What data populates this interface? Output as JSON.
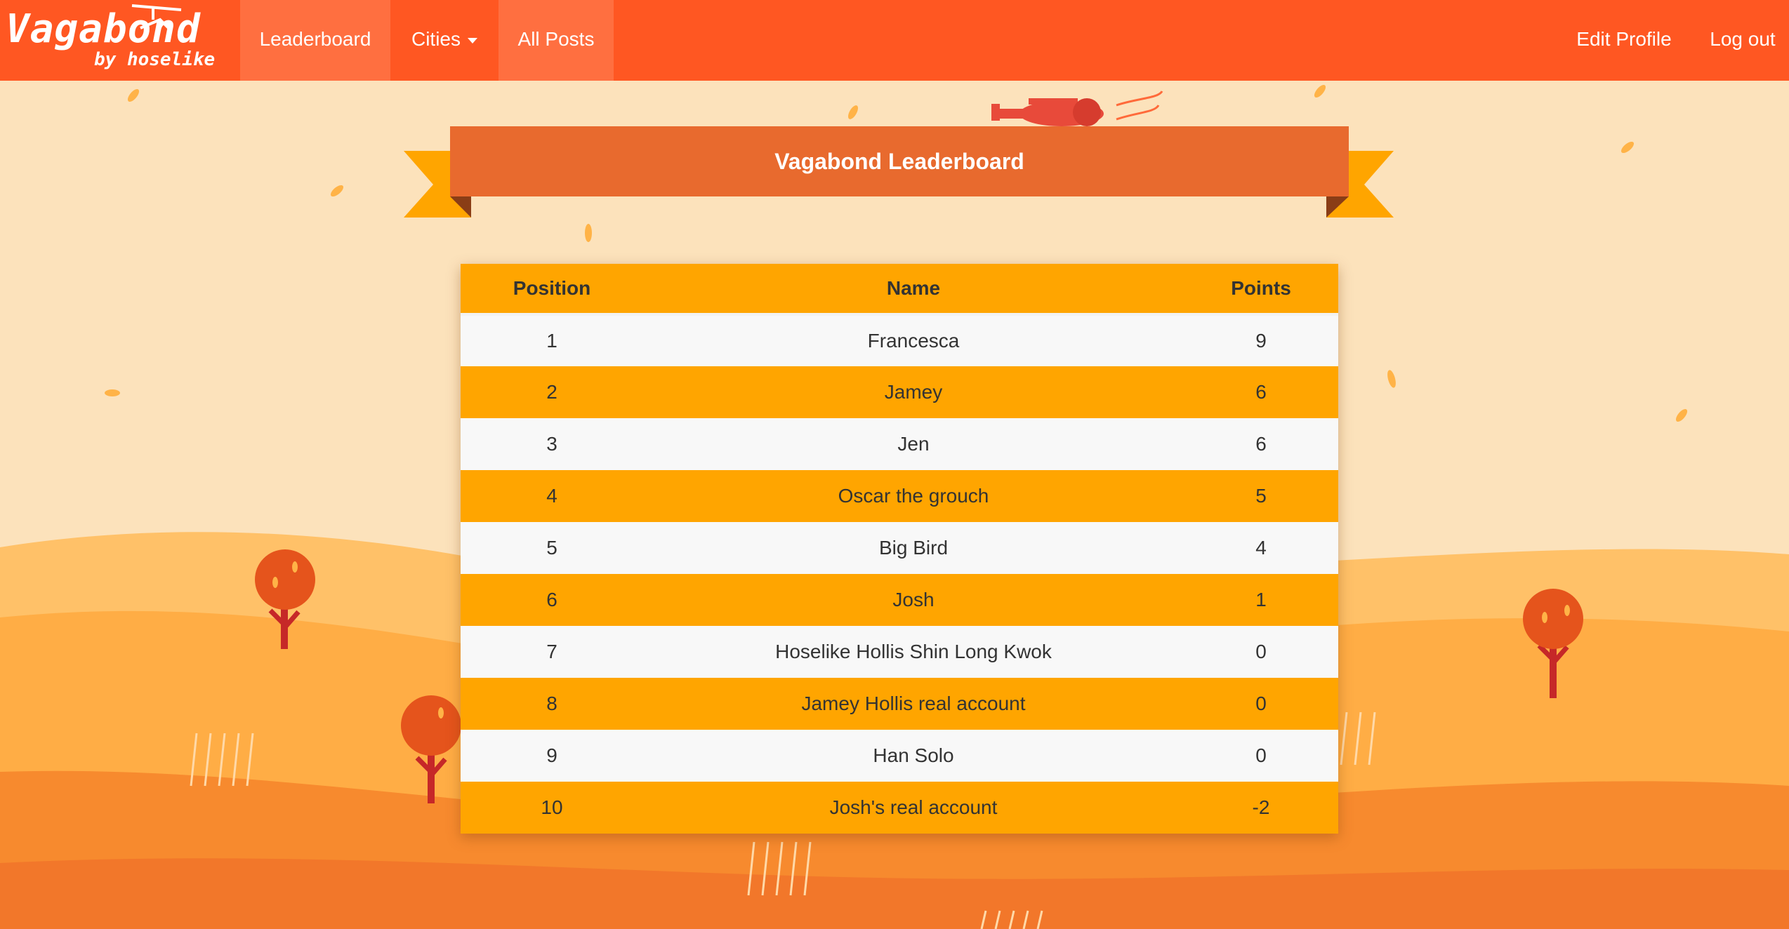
{
  "brand": {
    "name": "Vagabond",
    "tagline": "by hoselike",
    "logo_icon": "helicopter-icon"
  },
  "nav": {
    "leaderboard": "Leaderboard",
    "cities": "Cities",
    "all_posts": "All Posts",
    "edit_profile": "Edit Profile",
    "log_out": "Log out"
  },
  "banner": {
    "title": "Vagabond Leaderboard"
  },
  "table": {
    "headers": {
      "position": "Position",
      "name": "Name",
      "points": "Points"
    },
    "rows": [
      {
        "position": "1",
        "name": "Francesca",
        "points": "9"
      },
      {
        "position": "2",
        "name": "Jamey",
        "points": "6"
      },
      {
        "position": "3",
        "name": "Jen",
        "points": "6"
      },
      {
        "position": "4",
        "name": "Oscar the grouch",
        "points": "5"
      },
      {
        "position": "5",
        "name": "Big Bird",
        "points": "4"
      },
      {
        "position": "6",
        "name": "Josh",
        "points": "1"
      },
      {
        "position": "7",
        "name": "Hoselike Hollis Shin Long Kwok",
        "points": "0"
      },
      {
        "position": "8",
        "name": "Jamey Hollis real account",
        "points": "0"
      },
      {
        "position": "9",
        "name": "Han Solo",
        "points": "0"
      },
      {
        "position": "10",
        "name": "Josh's real account",
        "points": "-2"
      }
    ]
  },
  "colors": {
    "navbar": "#ff5722",
    "nav_active": "#ff6f40",
    "ribbon": "#e86a2e",
    "ribbon_tail": "#ffa500",
    "row_highlight": "#ffa500",
    "row_plain": "#f8f8f8",
    "sky": "#fce2bb"
  },
  "decorations": [
    "airplane-icon",
    "tree-icon",
    "wheat-icon",
    "leaf-icon"
  ]
}
